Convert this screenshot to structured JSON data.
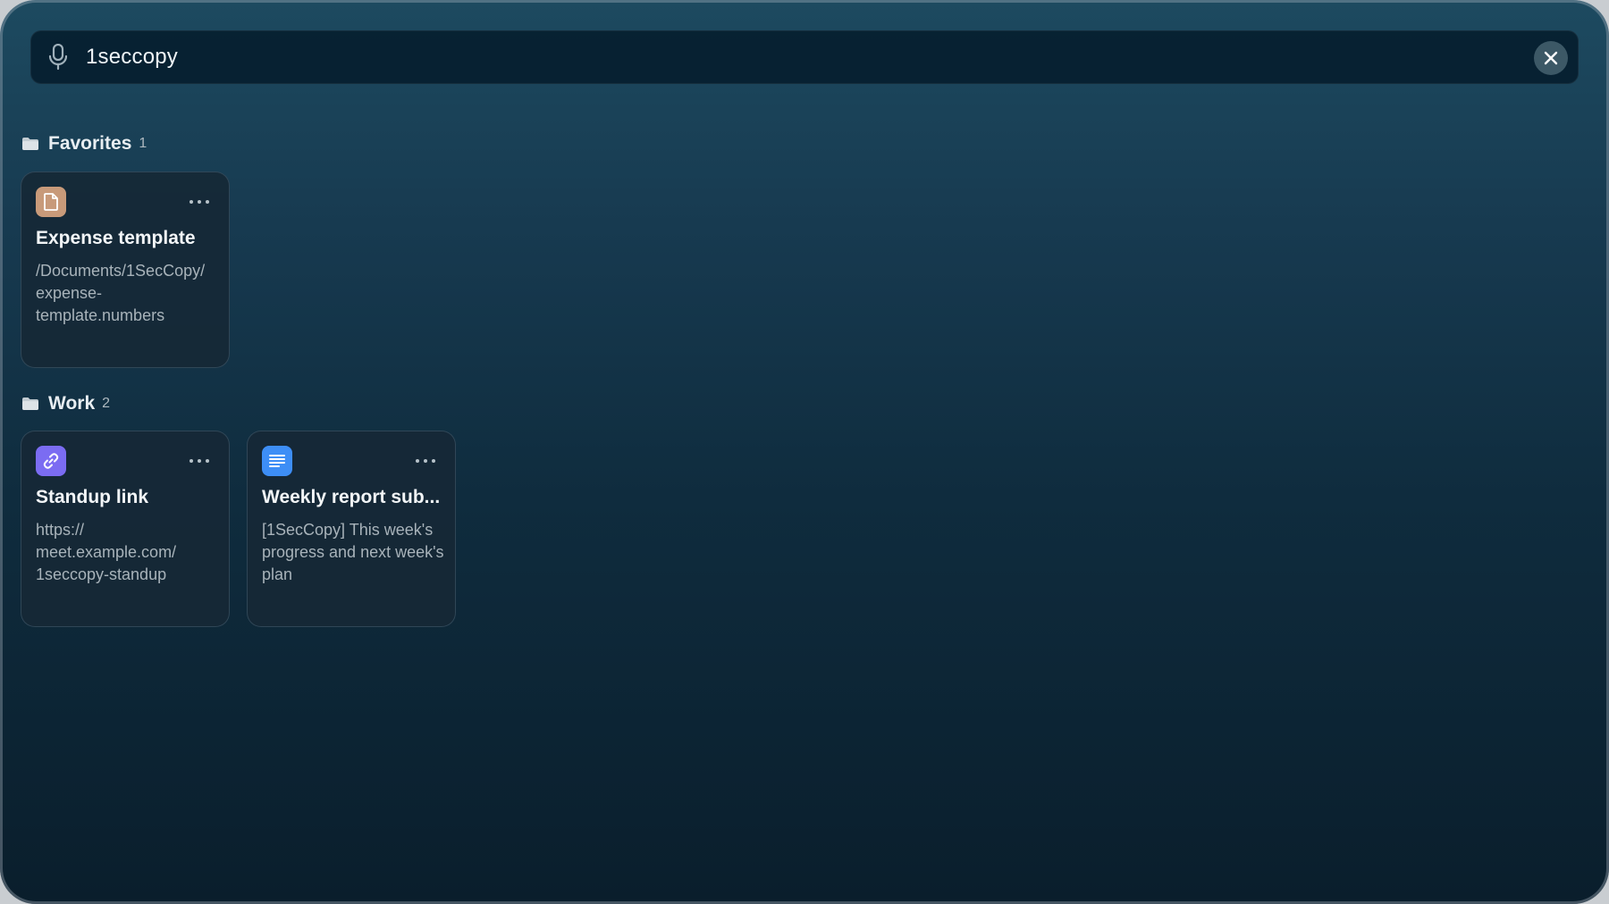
{
  "search": {
    "query": "1seccopy",
    "icon": "microphone-icon",
    "clear_icon": "close-icon"
  },
  "groups": [
    {
      "title": "Favorites",
      "count": "1",
      "items": [
        {
          "type": "file",
          "icon": "document-icon",
          "icon_color": "#c89a7a",
          "title": "Expense template",
          "body": "/Documents/1SecCopy/ expense-template.numbers"
        }
      ]
    },
    {
      "title": "Work",
      "count": "2",
      "items": [
        {
          "type": "link",
          "icon": "link-icon",
          "icon_color": "#7b6cf2",
          "title": "Standup link",
          "body": "https:// meet.example.com/ 1seccopy-standup"
        },
        {
          "type": "text",
          "icon": "text-lines-icon",
          "icon_color": "#3d8ef6",
          "title": "Weekly report sub...",
          "body": "[1SecCopy] This week's progress and next week's plan"
        }
      ]
    }
  ],
  "colors": {
    "background_top": "#1d4a60",
    "background_bottom": "#0a1e2c",
    "search_bar": "#041c2c",
    "card": "#162836"
  }
}
